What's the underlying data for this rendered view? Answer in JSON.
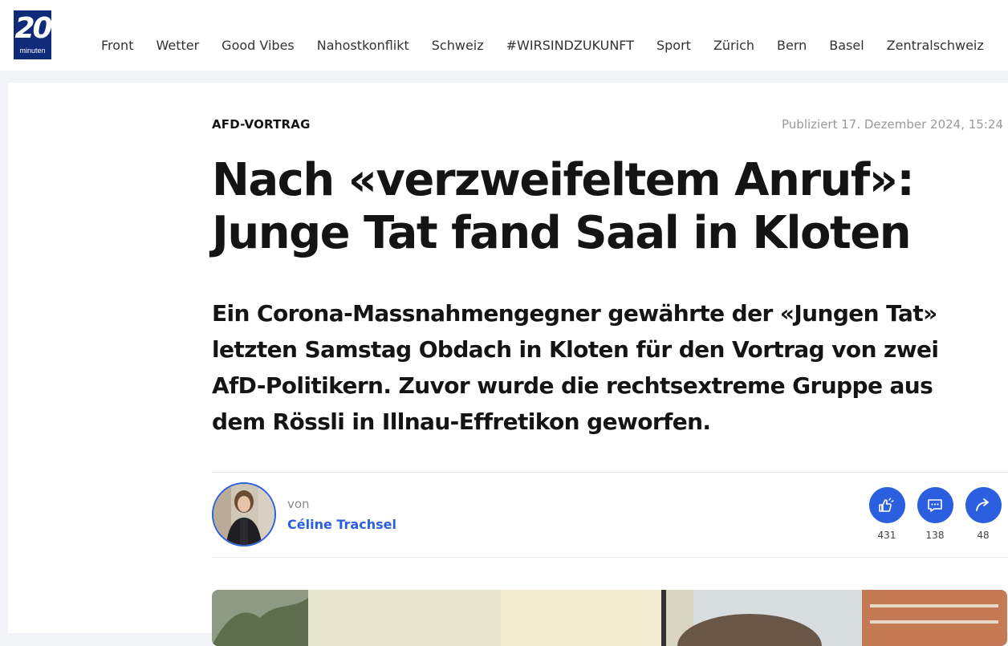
{
  "header": {
    "logo": {
      "number": "20",
      "word": "minuten"
    },
    "nav": [
      "Front",
      "Wetter",
      "Good Vibes",
      "Nahostkonflikt",
      "Schweiz",
      "#WIRSINDZUKUNFT",
      "Sport",
      "Zürich",
      "Bern",
      "Basel",
      "Zentralschweiz"
    ]
  },
  "article": {
    "kicker": "AFD-VORTRAG",
    "published": "Publiziert 17. Dezember 2024, 15:24",
    "headline": "Nach «verzweifeltem Anruf»: Junge Tat fand Saal in Kloten",
    "lead": "Ein Corona-Massnahmengegner gewährte der «Jungen Tat» letzten Samstag Obdach in Kloten für den Vortrag von zwei AfD-Politikern. Zuvor wurde die rechtsextreme Gruppe aus dem Rössli in Illnau-Effretikon geworfen.",
    "byline": {
      "prefix": "von",
      "author": "Céline Trachsel"
    },
    "actions": [
      {
        "icon": "reactions-icon",
        "count": "431"
      },
      {
        "icon": "comments-icon",
        "count": "138"
      },
      {
        "icon": "share-icon",
        "count": "48"
      }
    ]
  },
  "colors": {
    "brand": "#0f2a78",
    "accent": "#2b5fe0",
    "text": "#141414",
    "muted": "#9a9a9a"
  }
}
